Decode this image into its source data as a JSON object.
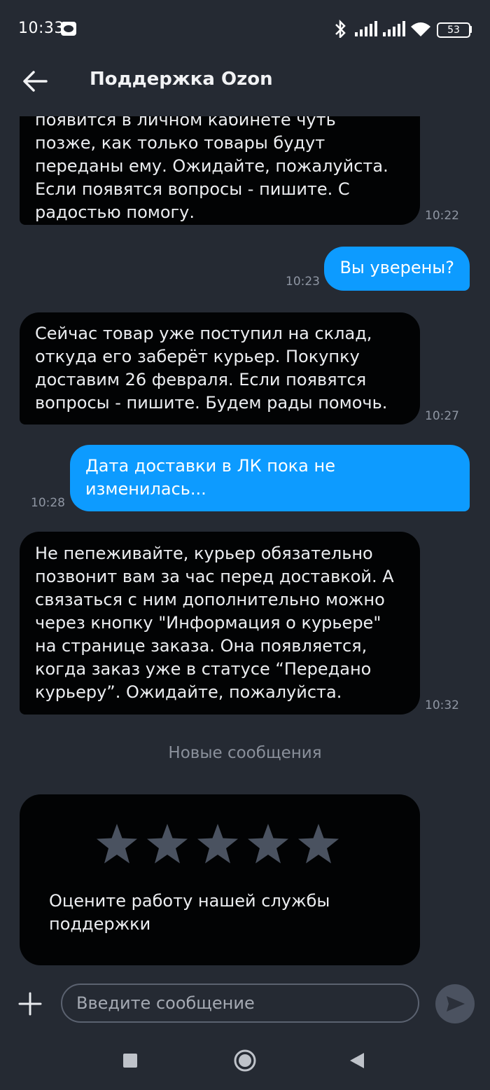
{
  "status_bar": {
    "time": "10:33",
    "battery": "53"
  },
  "header": {
    "title": "Поддержка Ozon"
  },
  "messages": [
    {
      "side": "in",
      "lines": [
        "появится в личном кабинете чуть",
        "позже, как только товары будут",
        "переданы ему. Ожидайте, пожалуйста.",
        "Если появятся вопросы - пишите. С",
        "радостью помогу."
      ],
      "time": "10:22"
    },
    {
      "side": "out",
      "lines": [
        "Вы уверены?"
      ],
      "time": "10:23"
    },
    {
      "side": "in",
      "lines": [
        "Сейчас товар уже поступил на склад,",
        "откуда его заберёт курьер. Покупку",
        "доставим 26 февраля. Если появятся",
        "вопросы - пишите. Будем рады помочь."
      ],
      "time": "10:27"
    },
    {
      "side": "out",
      "lines": [
        "Дата доставки в ЛК пока не",
        "изменилась..."
      ],
      "time": "10:28"
    },
    {
      "side": "in",
      "lines": [
        "Не пепеживайте, курьер обязательно",
        "позвонит вам за час перед доставкой. А",
        "связаться с ним дополнительно можно",
        "через кнопку \"Информация о курьере\"",
        "на странице заказа. Она появляется,",
        "когда заказ уже в статусе “Передано",
        "курьеру”. Ожидайте, пожалуйста."
      ],
      "time": "10:32"
    }
  ],
  "separator": "Новые сообщения",
  "rating": {
    "stars": 5,
    "lines": [
      "Оцените работу нашей службы",
      "поддержки"
    ]
  },
  "input": {
    "placeholder": "Введите сообщение"
  },
  "colors": {
    "incoming": "#020304",
    "outgoing": "#0d9bff",
    "background": "#252a33"
  }
}
